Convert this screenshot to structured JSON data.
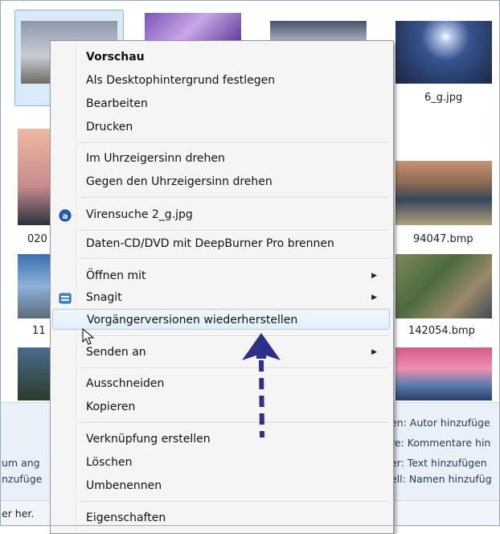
{
  "explorer": {
    "captions": {
      "c1": "6_g.jpg",
      "c2": "020",
      "c3": "94047.bmp",
      "c4": "11",
      "c5": "142054.bmp"
    },
    "details_left": [
      "um ang",
      "nzufüge"
    ],
    "details_right": [
      "en: Autor hinzufüge",
      "re: Kommentare hin",
      "er: Text hinzufügen",
      "ell: Namen hinzufüg"
    ],
    "status": "er her."
  },
  "menu": {
    "items": [
      {
        "label": "Vorschau"
      },
      {
        "label": "Als Desktophintergrund festlegen"
      },
      {
        "label": "Bearbeiten"
      },
      {
        "label": "Drucken"
      },
      {
        "label": "Im Uhrzeigersinn drehen"
      },
      {
        "label": "Gegen den Uhrzeigersinn drehen"
      },
      {
        "label": "Virensuche 2_g.jpg"
      },
      {
        "label": "Daten-CD/DVD mit DeepBurner Pro brennen"
      },
      {
        "label": "Öffnen mit"
      },
      {
        "label": "Snagit"
      },
      {
        "label": "Vorgängerversionen wiederherstellen"
      },
      {
        "label": "Senden an"
      },
      {
        "label": "Ausschneiden"
      },
      {
        "label": "Kopieren"
      },
      {
        "label": "Verknüpfung erstellen"
      },
      {
        "label": "Löschen"
      },
      {
        "label": "Umbenennen"
      },
      {
        "label": "Eigenschaften"
      }
    ]
  },
  "colors": {
    "hover_border": "#aecbef",
    "annotation_arrow": "#2d2f8c"
  }
}
